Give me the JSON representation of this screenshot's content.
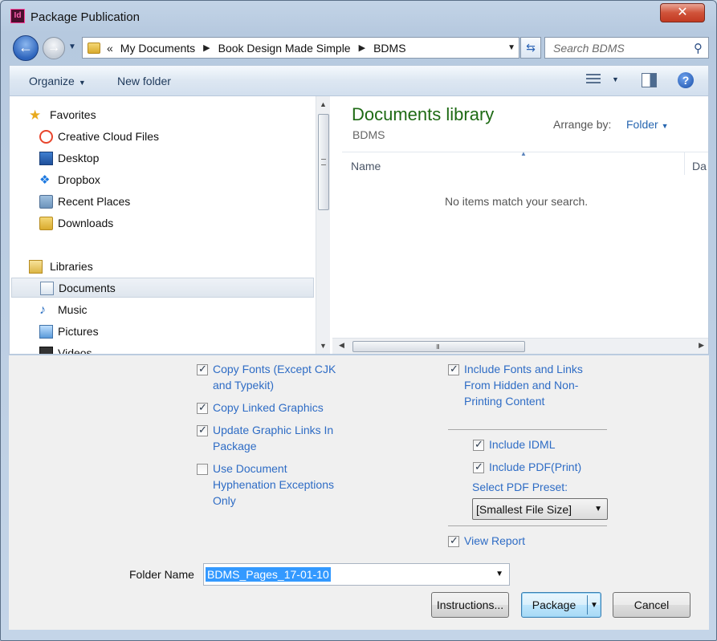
{
  "window": {
    "title": "Package Publication",
    "app_icon_text": "Id",
    "close_glyph": "✕"
  },
  "address": {
    "overflow": "«",
    "crumbs": [
      "My Documents",
      "Book Design Made Simple",
      "BDMS"
    ],
    "separator": "▶",
    "search_placeholder": "Search BDMS"
  },
  "toolbar": {
    "organize": "Organize",
    "new_folder": "New folder",
    "help": "?"
  },
  "nav": {
    "favorites": "Favorites",
    "favorite_items": [
      "Creative Cloud Files",
      "Desktop",
      "Dropbox",
      "Recent Places",
      "Downloads"
    ],
    "libraries": "Libraries",
    "library_items": [
      "Documents",
      "Music",
      "Pictures",
      "Videos"
    ],
    "selected": "Documents"
  },
  "content": {
    "title": "Documents library",
    "subtitle": "BDMS",
    "arrange_label": "Arrange by:",
    "arrange_value": "Folder",
    "column_name": "Name",
    "column_date": "Da",
    "empty_message": "No items match your search.",
    "hscroll_grip": "III"
  },
  "options": {
    "copy_fonts": {
      "label": "Copy Fonts (Except CJK and Typekit)",
      "checked": true
    },
    "copy_linked": {
      "label": "Copy Linked Graphics",
      "checked": true
    },
    "update_links": {
      "label": "Update Graphic Links In Package",
      "checked": true
    },
    "hyphenation": {
      "label": "Use Document Hyphenation Exceptions Only",
      "checked": false
    },
    "include_hidden": {
      "label": "Include Fonts and Links From Hidden and Non-Printing Content",
      "checked": true
    },
    "include_idml": {
      "label": "Include IDML",
      "checked": true
    },
    "include_pdf": {
      "label": "Include PDF(Print)",
      "checked": true
    },
    "pdf_preset_label": "Select PDF Preset:",
    "pdf_preset_value": "[Smallest File Size]",
    "view_report": {
      "label": "View Report",
      "checked": true
    }
  },
  "footer": {
    "folder_label": "Folder Name",
    "folder_value": "BDMS_Pages_17-01-10",
    "instructions": "Instructions...",
    "package": "Package",
    "cancel": "Cancel"
  }
}
